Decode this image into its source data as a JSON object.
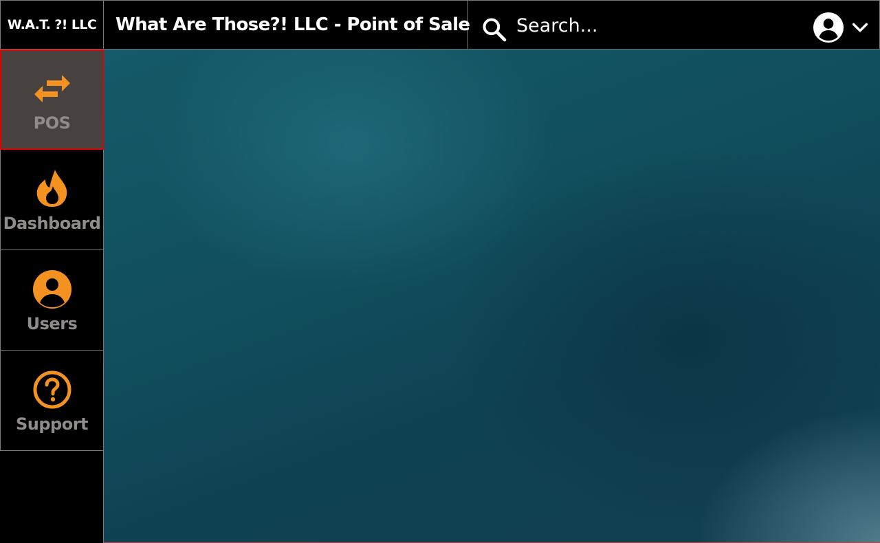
{
  "header": {
    "brand": "W.A.T. ?! LLC",
    "title": "What Are Those?! LLC - Point of Sale",
    "search_placeholder": "Search...",
    "user_icon": "account-circle-icon",
    "menu_icon": "chevron-down-icon"
  },
  "sidebar": {
    "items": [
      {
        "label": "POS",
        "icon": "swap-arrows-icon",
        "active": true
      },
      {
        "label": "Dashboard",
        "icon": "flame-icon",
        "active": false
      },
      {
        "label": "Users",
        "icon": "user-circle-icon",
        "active": false
      },
      {
        "label": "Support",
        "icon": "help-circle-icon",
        "active": false
      }
    ]
  },
  "colors": {
    "accent": "#f39221",
    "active_border": "#e00000",
    "active_bg": "#474140",
    "nav_label": "#8f8c8b",
    "background": "#000000",
    "content_teal": "#12505f"
  }
}
